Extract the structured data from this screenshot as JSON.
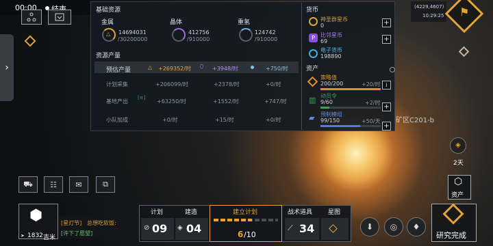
{
  "recording": {
    "time": "00:00",
    "end_label": "结束"
  },
  "coords": {
    "position": "(4229,4607)",
    "clock": "10:29:25"
  },
  "basic": {
    "title": "基础资源",
    "items": [
      {
        "name": "金属",
        "current": "14694031",
        "max": "/30200000"
      },
      {
        "name": "晶体",
        "current": "412756",
        "max": "/910000"
      },
      {
        "name": "重氢",
        "current": "124742",
        "max": "/910000"
      }
    ]
  },
  "output": {
    "title": "资源产量",
    "rows": [
      {
        "label": "预估产量",
        "metal": "+269352/时",
        "crystal": "+3948/时",
        "deut": "+750/时"
      },
      {
        "label": "计划采集",
        "metal": "+206099/时",
        "crystal": "+2378/时",
        "deut": "+0/时"
      },
      {
        "label": "基地产出",
        "metal": "+63250/时",
        "crystal": "+1552/时",
        "deut": "+747/时"
      },
      {
        "label": "小队加成",
        "metal": "+0/时",
        "crystal": "+15/时",
        "deut": "+0/时"
      }
    ]
  },
  "currency": {
    "title": "货币",
    "items": [
      {
        "name": "神圣群星币",
        "value": "0"
      },
      {
        "name": "比邻星币",
        "value": "69"
      },
      {
        "name": "电子货币",
        "value": "198890"
      }
    ]
  },
  "assets": {
    "title": "资产",
    "items": [
      {
        "name": "策略值",
        "value": "200/200",
        "rate": "+20/时",
        "fill": 1.0,
        "color": "#e0902a"
      },
      {
        "name": "动员令",
        "value": "9/60",
        "rate": "+2/时",
        "fill": 0.15,
        "color": "#3fa05a"
      },
      {
        "name": "预制模组",
        "value": "99/150",
        "rate": "+50/天",
        "fill": 0.66,
        "color": "#5a7ad8"
      }
    ]
  },
  "map": {
    "planet_label": "矿区C201-b",
    "days": "2天",
    "assets_button": "资产"
  },
  "player": {
    "distance": "1832",
    "unit": "吉米"
  },
  "chat": {
    "line1_channel": "[星灯节]",
    "line1_text": "总想吃软饭:",
    "line2_text": "[许下了愿望]"
  },
  "bottom": {
    "plan": {
      "label": "计划",
      "value": "09"
    },
    "build": {
      "label": "建造",
      "value": "04"
    },
    "build_plan": {
      "label": "建立计划",
      "current": "6",
      "max": "/10",
      "fill": 0.6
    },
    "tactic": {
      "label": "战术道具",
      "value": "34"
    },
    "star_map": {
      "label": "星图"
    },
    "research": {
      "label": "研究完成"
    }
  }
}
